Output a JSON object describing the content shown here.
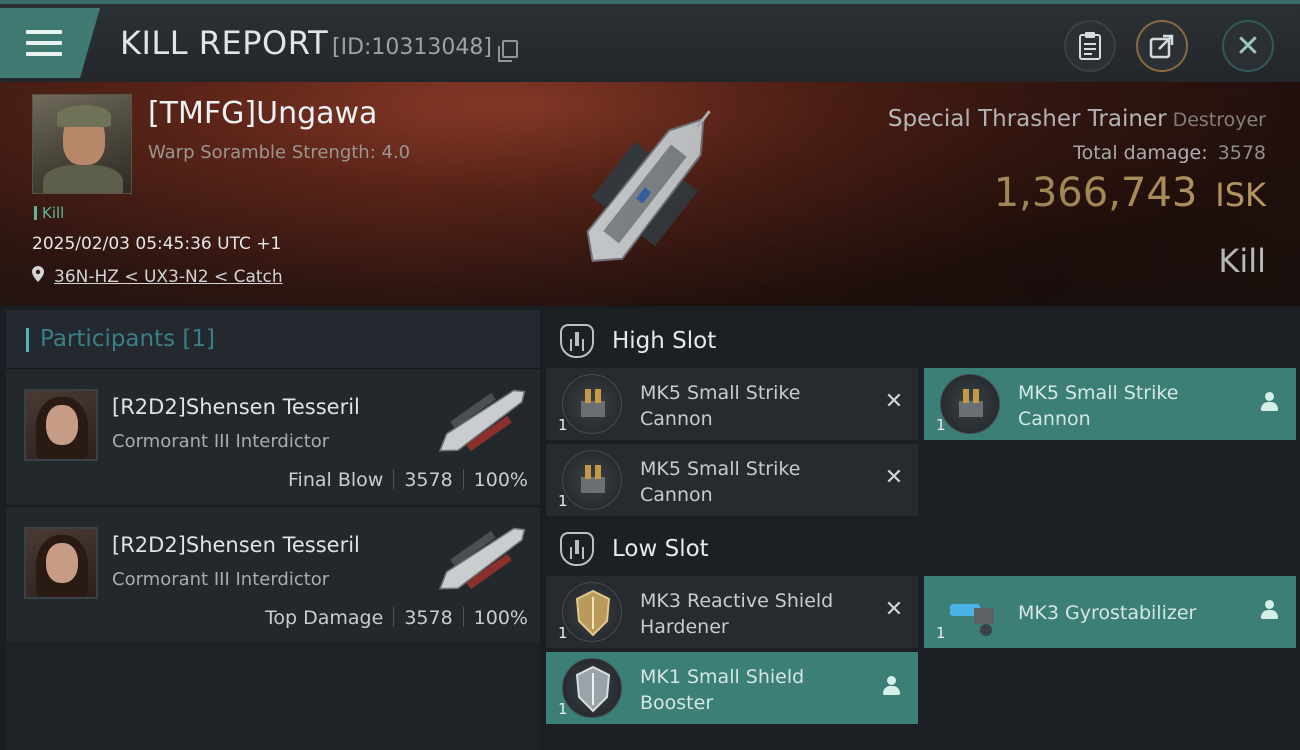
{
  "header": {
    "title": "KILL REPORT",
    "report_id": "[ID:10313048]"
  },
  "victim": {
    "name": "[TMFG]Ungawa",
    "warp_scramble": "Warp Soramble Strength: 4.0",
    "tag": "Kill",
    "datetime": "2025/02/03 05:45:36 UTC +1",
    "location": "36N-HZ < UX3-N2 < Catch"
  },
  "ship": {
    "name": "Special Thrasher Trainer",
    "class": "Destroyer",
    "total_damage_label": "Total damage:",
    "total_damage_value": "3578",
    "isk_value": "1,366,743",
    "isk_unit": "ISK",
    "result": "Kill"
  },
  "participants": {
    "header": "Participants [1]",
    "rows": [
      {
        "name": "[R2D2]Shensen Tesseril",
        "ship": "Cormorant III Interdictor",
        "role": "Final Blow",
        "damage": "3578",
        "percent": "100%"
      },
      {
        "name": "[R2D2]Shensen Tesseril",
        "ship": "Cormorant III Interdictor",
        "role": "Top Damage",
        "damage": "3578",
        "percent": "100%"
      }
    ]
  },
  "slots": {
    "high": {
      "label": "High Slot",
      "modules": [
        {
          "name": "MK5 Small Strike Cannon",
          "qty": "1",
          "status": "destroyed",
          "icon": "cannon-icon"
        },
        {
          "name": "MK5 Small Strike Cannon",
          "qty": "1",
          "status": "dropped",
          "icon": "cannon-icon"
        },
        {
          "name": "MK5 Small Strike Cannon",
          "qty": "1",
          "status": "destroyed",
          "icon": "cannon-icon"
        }
      ]
    },
    "low": {
      "label": "Low Slot",
      "modules": [
        {
          "name": "MK3 Reactive Shield Hardener",
          "qty": "1",
          "status": "destroyed",
          "icon": "shield-hardener-icon"
        },
        {
          "name": "MK3 Gyrostabilizer",
          "qty": "1",
          "status": "dropped",
          "icon": "gyrostabilizer-icon"
        },
        {
          "name": "MK1 Small Shield Booster",
          "qty": "1",
          "status": "dropped",
          "icon": "shield-booster-icon"
        }
      ]
    }
  },
  "colors": {
    "accent": "#3b7f77",
    "isk": "#e8c27a",
    "participants_header": "#3a7f86"
  }
}
